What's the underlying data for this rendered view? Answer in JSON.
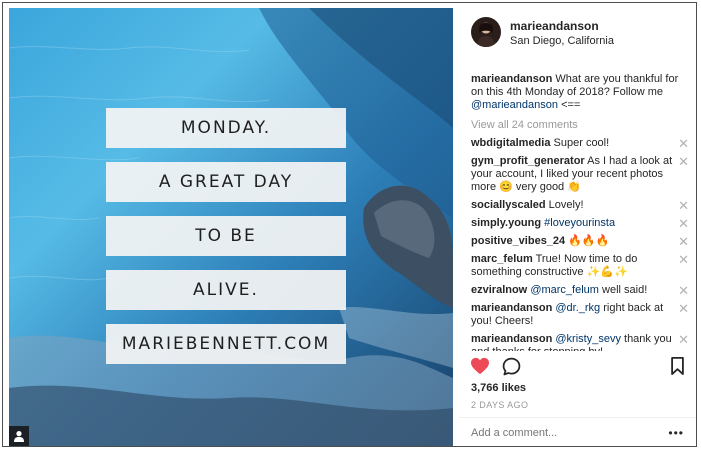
{
  "post": {
    "quote_lines": [
      "MONDAY.",
      "A GREAT DAY",
      "TO BE",
      "ALIVE.",
      "MARIEBENNETT.COM"
    ]
  },
  "header": {
    "username": "marieandanson",
    "location": "San Diego, California"
  },
  "caption": {
    "username": "marieandanson",
    "text": "What are you thankful for on this 4th Monday of 2018? Follow me",
    "mention": "@marieandanson",
    "suffix": "<=="
  },
  "view_all_label": "View all 24 comments",
  "comments": [
    {
      "user": "wbdigitalmedia",
      "pre": "Super cool!",
      "link": "",
      "post": ""
    },
    {
      "user": "gym_profit_generator",
      "pre": "As I had a look at your account, I liked your recent photos more 😊 very good 👏",
      "link": "",
      "post": ""
    },
    {
      "user": "sociallyscaled",
      "pre": "Lovely!",
      "link": "",
      "post": ""
    },
    {
      "user": "simply.young",
      "pre": "",
      "link": "#loveyourinsta",
      "post": ""
    },
    {
      "user": "positive_vibes_24",
      "pre": "🔥🔥🔥",
      "link": "",
      "post": ""
    },
    {
      "user": "marc_felum",
      "pre": "True! Now time to do something constructive ✨💪✨",
      "link": "",
      "post": ""
    },
    {
      "user": "ezviralnow",
      "pre": "",
      "link": "@marc_felum",
      "post": " well said!"
    },
    {
      "user": "marieandanson",
      "pre": "",
      "link": "@dr._rkg",
      "post": " right back at you! Cheers!"
    },
    {
      "user": "marieandanson",
      "pre": "",
      "link": "@kristy_sevy",
      "post": " thank you and thanks for stopping by!"
    }
  ],
  "close_glyph": "✕",
  "likes": "3,766 likes",
  "date": "2 DAYS AGO",
  "add_comment_placeholder": "Add a comment...",
  "more_label": "•••",
  "colors": {
    "heart": "#ed4956",
    "link": "#003569",
    "muted": "#999999"
  },
  "icons": {
    "like": "heart-icon",
    "comment": "comment-bubble-icon",
    "save": "bookmark-icon",
    "user_tag": "user-tag-icon"
  }
}
